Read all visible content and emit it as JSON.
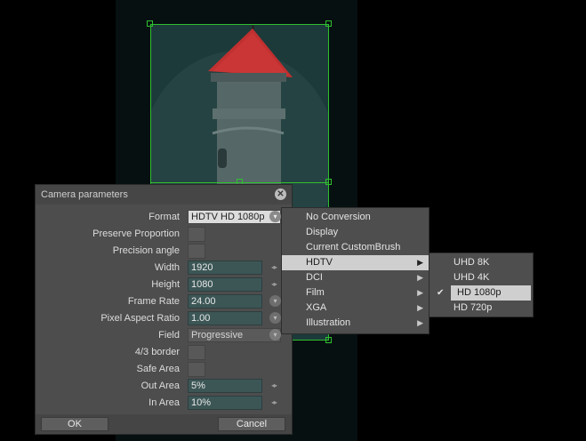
{
  "dialog": {
    "title": "Camera parameters",
    "close_glyph": "✕",
    "rows": {
      "format": {
        "label": "Format",
        "value": "HDTV  HD 1080p"
      },
      "preserve": {
        "label": "Preserve Proportion"
      },
      "precision": {
        "label": "Precision angle"
      },
      "width": {
        "label": "Width",
        "value": "1920"
      },
      "height": {
        "label": "Height",
        "value": "1080"
      },
      "framerate": {
        "label": "Frame Rate",
        "value": "24.00"
      },
      "par": {
        "label": "Pixel Aspect Ratio",
        "value": "1.00"
      },
      "field": {
        "label": "Field",
        "value": "Progressive"
      },
      "border43": {
        "label": "4/3 border"
      },
      "safearea": {
        "label": "Safe Area"
      },
      "outarea": {
        "label": "Out Area",
        "value": "5%"
      },
      "inarea": {
        "label": "In Area",
        "value": "10%"
      }
    },
    "ok_label": "OK",
    "cancel_label": "Cancel",
    "spin_glyph": "◂▸",
    "dropdown_glyph": "▾"
  },
  "format_menu": {
    "items": [
      {
        "label": "No Conversion",
        "has_submenu": false
      },
      {
        "label": "Display",
        "has_submenu": false
      },
      {
        "label": "Current CustomBrush",
        "has_submenu": false
      },
      {
        "label": "HDTV",
        "has_submenu": true,
        "selected": true
      },
      {
        "label": "DCI",
        "has_submenu": true
      },
      {
        "label": "Film",
        "has_submenu": true
      },
      {
        "label": "XGA",
        "has_submenu": true
      },
      {
        "label": "Illustration",
        "has_submenu": true
      }
    ],
    "arrow_glyph": "▶"
  },
  "hdtv_submenu": {
    "items": [
      {
        "label": "UHD 8K"
      },
      {
        "label": "UHD 4K"
      },
      {
        "label": "HD 1080p",
        "checked": true
      },
      {
        "label": "HD 720p"
      }
    ],
    "check_glyph": "✔"
  },
  "colors": {
    "guide_green": "#2fbf2f",
    "dialog_bg": "#4d4d4d",
    "field_bg": "#3c5656",
    "menu_highlight": "#cfcfcf"
  }
}
